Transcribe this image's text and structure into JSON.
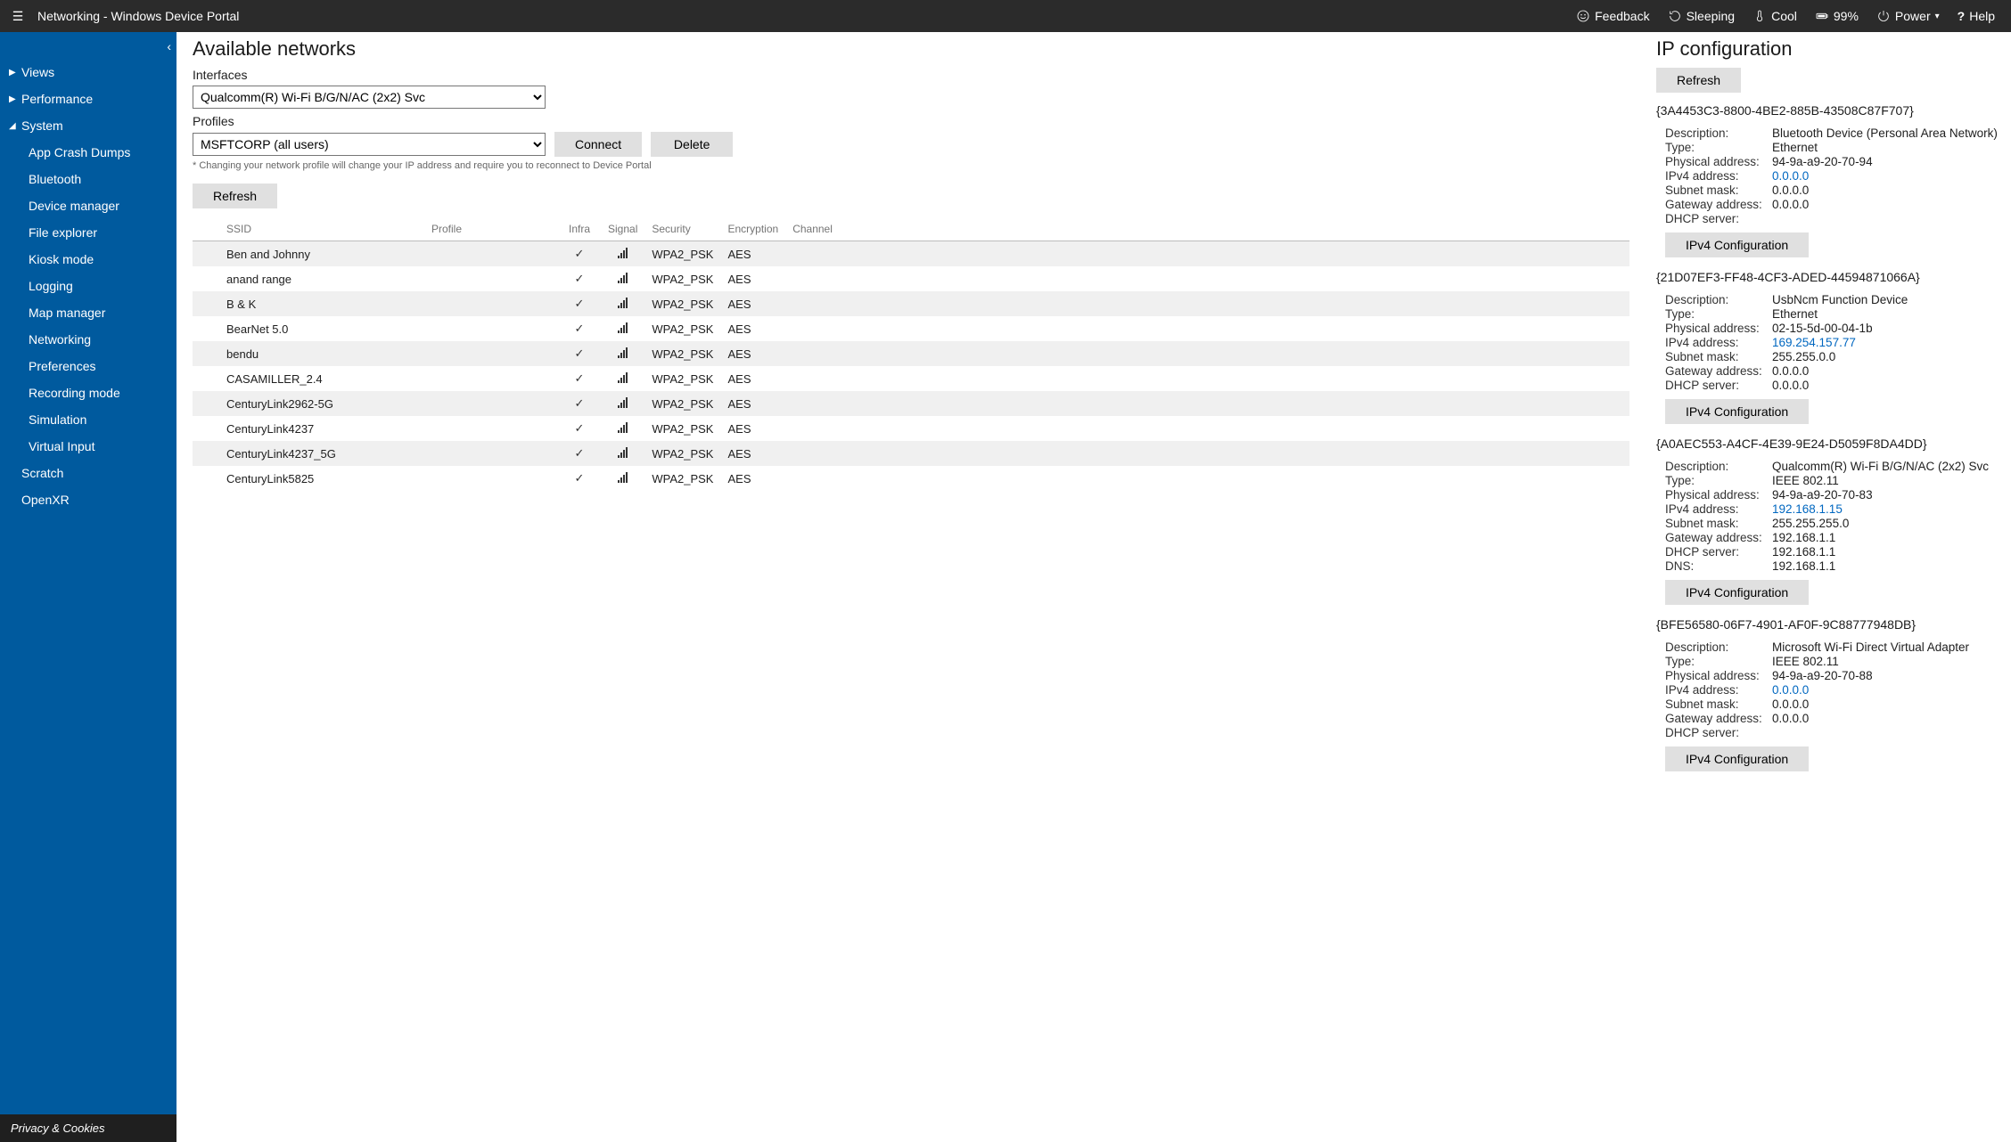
{
  "header": {
    "title": "Networking - Windows Device Portal",
    "feedback": "Feedback",
    "sleeping": "Sleeping",
    "cool": "Cool",
    "battery": "99%",
    "power": "Power",
    "help": "Help"
  },
  "sidebar": {
    "groups": [
      {
        "label": "Views",
        "expanded": false,
        "items": []
      },
      {
        "label": "Performance",
        "expanded": false,
        "items": []
      },
      {
        "label": "System",
        "expanded": true,
        "items": [
          "App Crash Dumps",
          "Bluetooth",
          "Device manager",
          "File explorer",
          "Kiosk mode",
          "Logging",
          "Map manager",
          "Networking",
          "Preferences",
          "Recording mode",
          "Simulation",
          "Virtual Input"
        ]
      }
    ],
    "extra": [
      "Scratch",
      "OpenXR"
    ],
    "footer": "Privacy & Cookies"
  },
  "available": {
    "title": "Available networks",
    "interfaces_label": "Interfaces",
    "interface_selected": "Qualcomm(R) Wi-Fi B/G/N/AC (2x2) Svc",
    "profiles_label": "Profiles",
    "profile_selected": "MSFTCORP (all users)",
    "connect": "Connect",
    "delete": "Delete",
    "note": "* Changing your network profile will change your IP address and require you to reconnect to Device Portal",
    "refresh": "Refresh",
    "columns": [
      "",
      "SSID",
      "Profile",
      "Infra",
      "Signal",
      "Security",
      "Encryption",
      "Channel"
    ],
    "rows": [
      {
        "ssid": "Ben and Johnny",
        "profile": "",
        "infra": true,
        "signal": 4,
        "security": "WPA2_PSK",
        "encryption": "AES",
        "channel": ""
      },
      {
        "ssid": "anand range",
        "profile": "",
        "infra": true,
        "signal": 4,
        "security": "WPA2_PSK",
        "encryption": "AES",
        "channel": ""
      },
      {
        "ssid": "B & K",
        "profile": "",
        "infra": true,
        "signal": 4,
        "security": "WPA2_PSK",
        "encryption": "AES",
        "channel": ""
      },
      {
        "ssid": "BearNet 5.0",
        "profile": "",
        "infra": true,
        "signal": 4,
        "security": "WPA2_PSK",
        "encryption": "AES",
        "channel": ""
      },
      {
        "ssid": "bendu",
        "profile": "",
        "infra": true,
        "signal": 4,
        "security": "WPA2_PSK",
        "encryption": "AES",
        "channel": ""
      },
      {
        "ssid": "CASAMILLER_2.4",
        "profile": "",
        "infra": true,
        "signal": 4,
        "security": "WPA2_PSK",
        "encryption": "AES",
        "channel": ""
      },
      {
        "ssid": "CenturyLink2962-5G",
        "profile": "",
        "infra": true,
        "signal": 4,
        "security": "WPA2_PSK",
        "encryption": "AES",
        "channel": ""
      },
      {
        "ssid": "CenturyLink4237",
        "profile": "",
        "infra": true,
        "signal": 4,
        "security": "WPA2_PSK",
        "encryption": "AES",
        "channel": ""
      },
      {
        "ssid": "CenturyLink4237_5G",
        "profile": "",
        "infra": true,
        "signal": 4,
        "security": "WPA2_PSK",
        "encryption": "AES",
        "channel": ""
      },
      {
        "ssid": "CenturyLink5825",
        "profile": "",
        "infra": true,
        "signal": 4,
        "security": "WPA2_PSK",
        "encryption": "AES",
        "channel": ""
      }
    ]
  },
  "ipconfig": {
    "title": "IP configuration",
    "refresh": "Refresh",
    "config_button": "IPv4 Configuration",
    "field_labels": {
      "description": "Description:",
      "type": "Type:",
      "physical": "Physical address:",
      "ipv4": "IPv4 address:",
      "subnet": "Subnet mask:",
      "gateway": "Gateway address:",
      "dhcp": "DHCP server:",
      "dns": "DNS:"
    },
    "adapters": [
      {
        "guid": "{3A4453C3-8800-4BE2-885B-43508C87F707}",
        "description": "Bluetooth Device (Personal Area Network)",
        "type": "Ethernet",
        "physical": "94-9a-a9-20-70-94",
        "ipv4": "0.0.0.0",
        "subnet": "0.0.0.0",
        "gateway": "0.0.0.0",
        "dhcp": ""
      },
      {
        "guid": "{21D07EF3-FF48-4CF3-ADED-44594871066A}",
        "description": "UsbNcm Function Device",
        "type": "Ethernet",
        "physical": "02-15-5d-00-04-1b",
        "ipv4": "169.254.157.77",
        "subnet": "255.255.0.0",
        "gateway": "0.0.0.0",
        "dhcp": "0.0.0.0"
      },
      {
        "guid": "{A0AEC553-A4CF-4E39-9E24-D5059F8DA4DD}",
        "description": "Qualcomm(R) Wi-Fi B/G/N/AC (2x2) Svc",
        "type": "IEEE 802.11",
        "physical": "94-9a-a9-20-70-83",
        "ipv4": "192.168.1.15",
        "subnet": "255.255.255.0",
        "gateway": "192.168.1.1",
        "dhcp": "192.168.1.1",
        "dns": "192.168.1.1"
      },
      {
        "guid": "{BFE56580-06F7-4901-AF0F-9C88777948DB}",
        "description": "Microsoft Wi-Fi Direct Virtual Adapter",
        "type": "IEEE 802.11",
        "physical": "94-9a-a9-20-70-88",
        "ipv4": "0.0.0.0",
        "subnet": "0.0.0.0",
        "gateway": "0.0.0.0",
        "dhcp": ""
      }
    ]
  }
}
